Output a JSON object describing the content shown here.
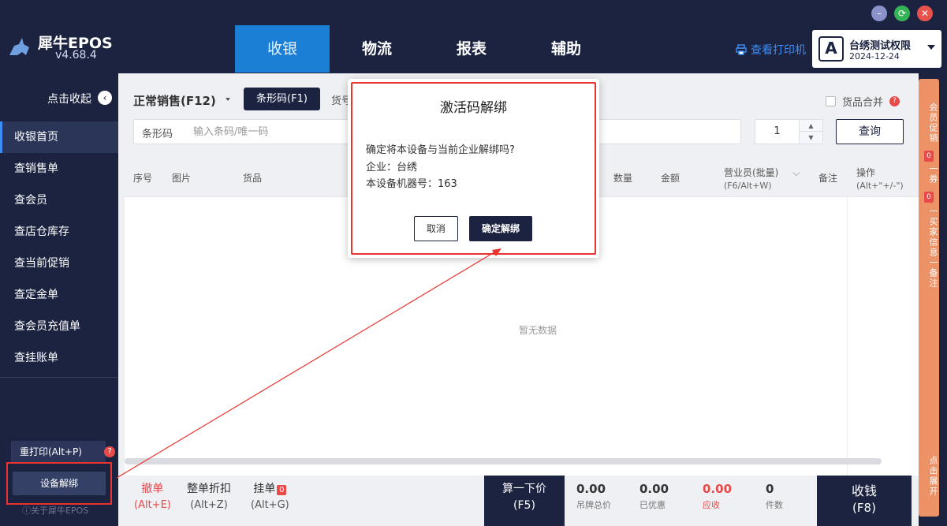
{
  "app": {
    "name": "犀牛EPOS",
    "version": "v4.68.4"
  },
  "nav": {
    "tabs": [
      "收银",
      "物流",
      "报表",
      "辅助"
    ],
    "active": "收银"
  },
  "header": {
    "printer_link": "查看打印机",
    "user_name": "台绣测试权限",
    "user_date": "2024-12-24",
    "user_avatar": "A"
  },
  "sidebar": {
    "collapse_label": "点击收起",
    "items": [
      "收银首页",
      "查销售单",
      "查会员",
      "查店仓库存",
      "查当前促销",
      "查定金单",
      "查会员充值单",
      "查挂账单"
    ],
    "reprint": "重打印(Alt+P)",
    "unbind": "设备解绑",
    "about": "ⓘ关于犀牛EPOS"
  },
  "toolbar": {
    "sale_mode": "正常销售(F12)",
    "barcode_btn": "条形码(F1)",
    "goods_tab": "货号",
    "merge_label": "货品合并",
    "search_label": "条形码",
    "search_placeholder": "输入条码/唯一码",
    "qty": "1",
    "query": "查询"
  },
  "table": {
    "headers": [
      "序号",
      "图片",
      "货品",
      "数量",
      "金额",
      "营业员(批量)",
      "备注",
      "操作"
    ],
    "salesman_sub": "(F6/Alt+W)",
    "op_sub": "(Alt+\"+/-\")",
    "empty": "暂无数据"
  },
  "side_panel": {
    "promo": "会员促销",
    "promo_count": "0",
    "coupon": "一券",
    "coupon_count": "0",
    "buyer": "一买家信息一备注",
    "expand": "点击展开"
  },
  "footer": {
    "cancel": "撤单",
    "cancel_key": "(Alt+E)",
    "discount": "整单折扣",
    "discount_key": "(Alt+Z)",
    "hold": "挂单",
    "hold_count": "0",
    "hold_key": "(Alt+G)",
    "calc": "算一下价",
    "calc_key": "(F5)",
    "totals": [
      {
        "value": "0.00",
        "label": "吊牌总价"
      },
      {
        "value": "0.00",
        "label": "已优惠"
      },
      {
        "value": "0.00",
        "label": "应收"
      },
      {
        "value": "0",
        "label": "件数"
      }
    ],
    "pay": "收钱",
    "pay_key": "(F8)"
  },
  "modal": {
    "title": "激活码解绑",
    "question": "确定将本设备与当前企业解绑吗?",
    "company": "企业：台绣",
    "machine": "本设备机器号：163",
    "cancel": "取消",
    "confirm": "确定解绑"
  },
  "colors": {
    "dark": "#1c2340",
    "accent": "#1b7fd6",
    "red": "#e84a4a",
    "panel": "#ec9266"
  },
  "icons": [
    "rhino-logo-icon",
    "printer-icon",
    "chevron-left-icon",
    "question-icon",
    "minimize-icon",
    "maximize-icon",
    "close-icon"
  ]
}
